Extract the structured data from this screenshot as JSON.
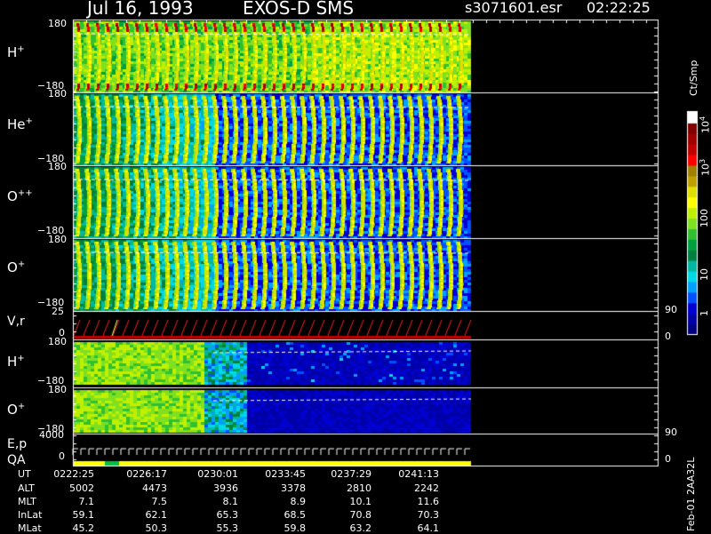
{
  "header": {
    "date": "Jul 16, 1993",
    "instrument": "EXOS-D SMS",
    "filename": "s3071601.esr",
    "time": "02:22:25"
  },
  "colorbar": {
    "unit": "Ct/Smp",
    "tick_labels": [
      "1",
      "10",
      "100",
      "10",
      "3",
      "10",
      "4"
    ],
    "colors": [
      "#000080",
      "#0000a8",
      "#0000d0",
      "#0050ff",
      "#00a0ff",
      "#00d8e8",
      "#00b8a0",
      "#008040",
      "#00a040",
      "#30c030",
      "#80e020",
      "#c0f000",
      "#ffff00",
      "#e0e000",
      "#c0a000",
      "#a08000",
      "#ff0000",
      "#c00000",
      "#a00000",
      "#800000",
      "#ffffff"
    ]
  },
  "footer": {
    "stamp": "Feb-01 2AA32L"
  },
  "chart_data": {
    "type": "heatmap",
    "panels": [
      {
        "label": "H",
        "sup": "+",
        "ytick_top": "180",
        "ytick_bottom": "−180",
        "ylim": [
          -180,
          180
        ]
      },
      {
        "label": "He",
        "sup": "+",
        "ytick_top": "180",
        "ytick_bottom": "−180",
        "ylim": [
          -180,
          180
        ]
      },
      {
        "label": "O",
        "sup": "++",
        "ytick_top": "180",
        "ytick_bottom": "−180",
        "ylim": [
          -180,
          180
        ]
      },
      {
        "label": "O",
        "sup": "+",
        "ytick_top": "180",
        "ytick_bottom": "−180",
        "ylim": [
          -180,
          180
        ]
      },
      {
        "label": "V,r",
        "sup": "",
        "ytick_top": "25",
        "ytick_mid": "0",
        "right_top": "90",
        "right_bottom": "0"
      },
      {
        "label": "H",
        "sup": "+",
        "ytick_top": "180",
        "ytick_bottom": "−180",
        "ylim": [
          -180,
          180
        ]
      },
      {
        "label": "O",
        "sup": "+",
        "ytick_top": "180",
        "ytick_bottom": "−180",
        "ylim": [
          -180,
          180
        ]
      },
      {
        "label": "E,p",
        "label2": "QA",
        "ytick_top": "4000",
        "ytick_mid": "0",
        "right_top": "90",
        "right_bottom": "0"
      }
    ],
    "ephemeris": {
      "row_labels": [
        "UT",
        "ALT",
        "MLT",
        "InLat",
        "MLat"
      ],
      "columns": [
        {
          "UT": "0222:25",
          "ALT": "5002",
          "MLT": "7.1",
          "InLat": "59.1",
          "MLat": "45.2"
        },
        {
          "UT": "0226:17",
          "ALT": "4473",
          "MLT": "7.5",
          "InLat": "62.1",
          "MLat": "50.3"
        },
        {
          "UT": "0230:01",
          "ALT": "3936",
          "MLT": "8.1",
          "InLat": "65.3",
          "MLat": "55.3"
        },
        {
          "UT": "0233:45",
          "ALT": "3378",
          "MLT": "8.9",
          "InLat": "68.5",
          "MLat": "59.8"
        },
        {
          "UT": "0237:29",
          "ALT": "2810",
          "MLT": "10.1",
          "InLat": "70.8",
          "MLat": "63.2"
        },
        {
          "UT": "0241:13",
          "ALT": "2242",
          "MLT": "11.6",
          "InLat": "70.3",
          "MLat": "64.1"
        }
      ]
    }
  }
}
